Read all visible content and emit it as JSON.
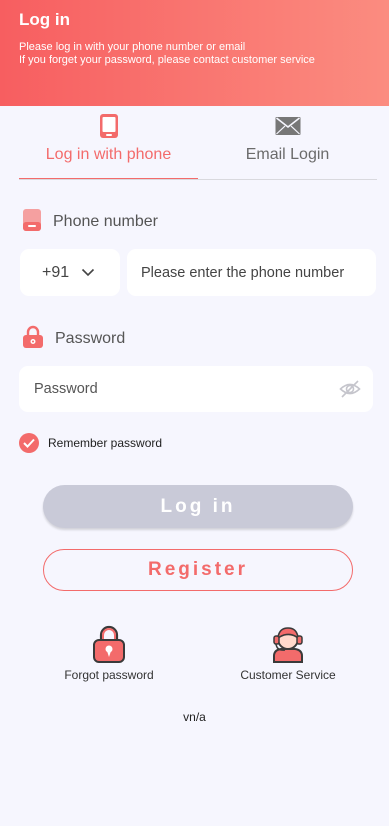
{
  "header": {
    "title": "Log in",
    "line1": "Please log in with your phone number or email",
    "line2": "If you forget your password, please contact customer service"
  },
  "tabs": [
    {
      "label": "Log in with phone",
      "icon": "phone-icon",
      "active": true
    },
    {
      "label": "Email Login",
      "icon": "mail-icon",
      "active": false
    }
  ],
  "phone": {
    "label": "Phone number",
    "country_code": "+91",
    "placeholder": "Please enter the phone number"
  },
  "password": {
    "label": "Password",
    "placeholder": "Password"
  },
  "remember": {
    "label": "Remember password",
    "checked": true
  },
  "buttons": {
    "login": "Log in",
    "register": "Register"
  },
  "links": {
    "forgot": "Forgot password",
    "service": "Customer Service"
  },
  "version": "vn/a",
  "colors": {
    "accent": "#f36b6b",
    "header_start": "#f75e60",
    "header_end": "#fb8c80",
    "login_disabled": "#c9cad8",
    "background": "#f6f6fe"
  }
}
